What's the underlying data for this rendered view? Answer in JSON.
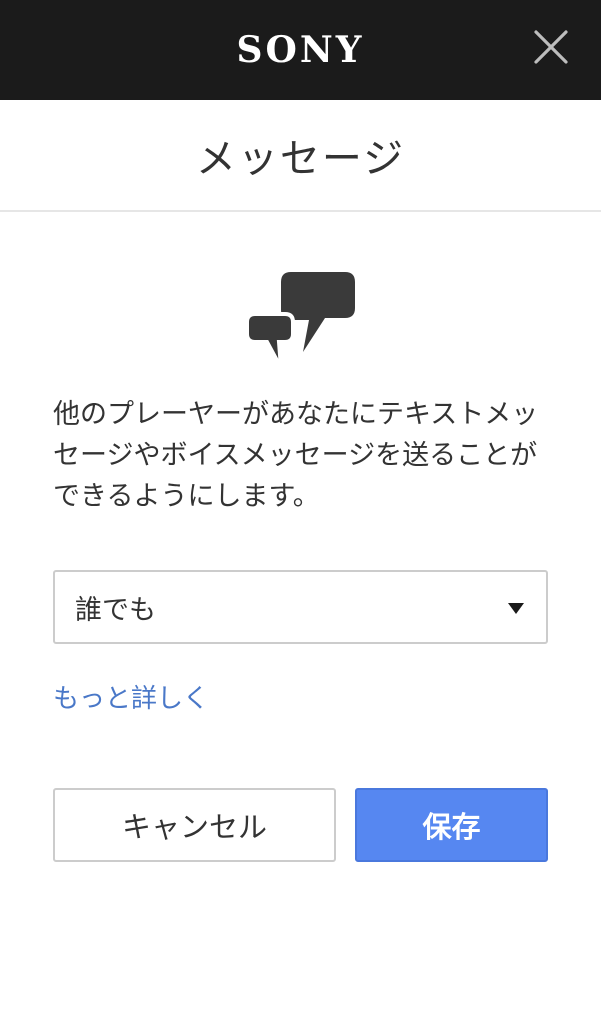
{
  "header": {
    "brand": "SONY",
    "close_icon": "close-icon"
  },
  "title": "メッセージ",
  "icon": "chat-bubbles-icon",
  "description": "他のプレーヤーがあなたにテキストメッセージやボイスメッセージを送ることができるようにします。",
  "select": {
    "value": "誰でも"
  },
  "learn_more": "もっと詳しく",
  "buttons": {
    "cancel": "キャンセル",
    "save": "保存"
  },
  "colors": {
    "topbar": "#1b1b1b",
    "link": "#4a78c8",
    "primary": "#5687f1",
    "icon": "#3a3a3a"
  }
}
